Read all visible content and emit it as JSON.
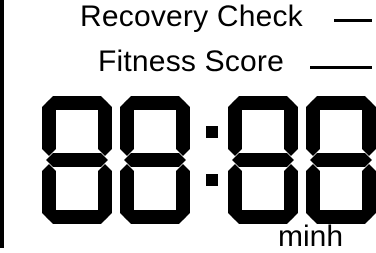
{
  "labels": {
    "recovery_check": "Recovery Check",
    "fitness_score": "Fitness Score"
  },
  "display": {
    "value": "88:88",
    "unit": "minh"
  },
  "colors": {
    "segment": "#000000",
    "background": "#ffffff"
  }
}
